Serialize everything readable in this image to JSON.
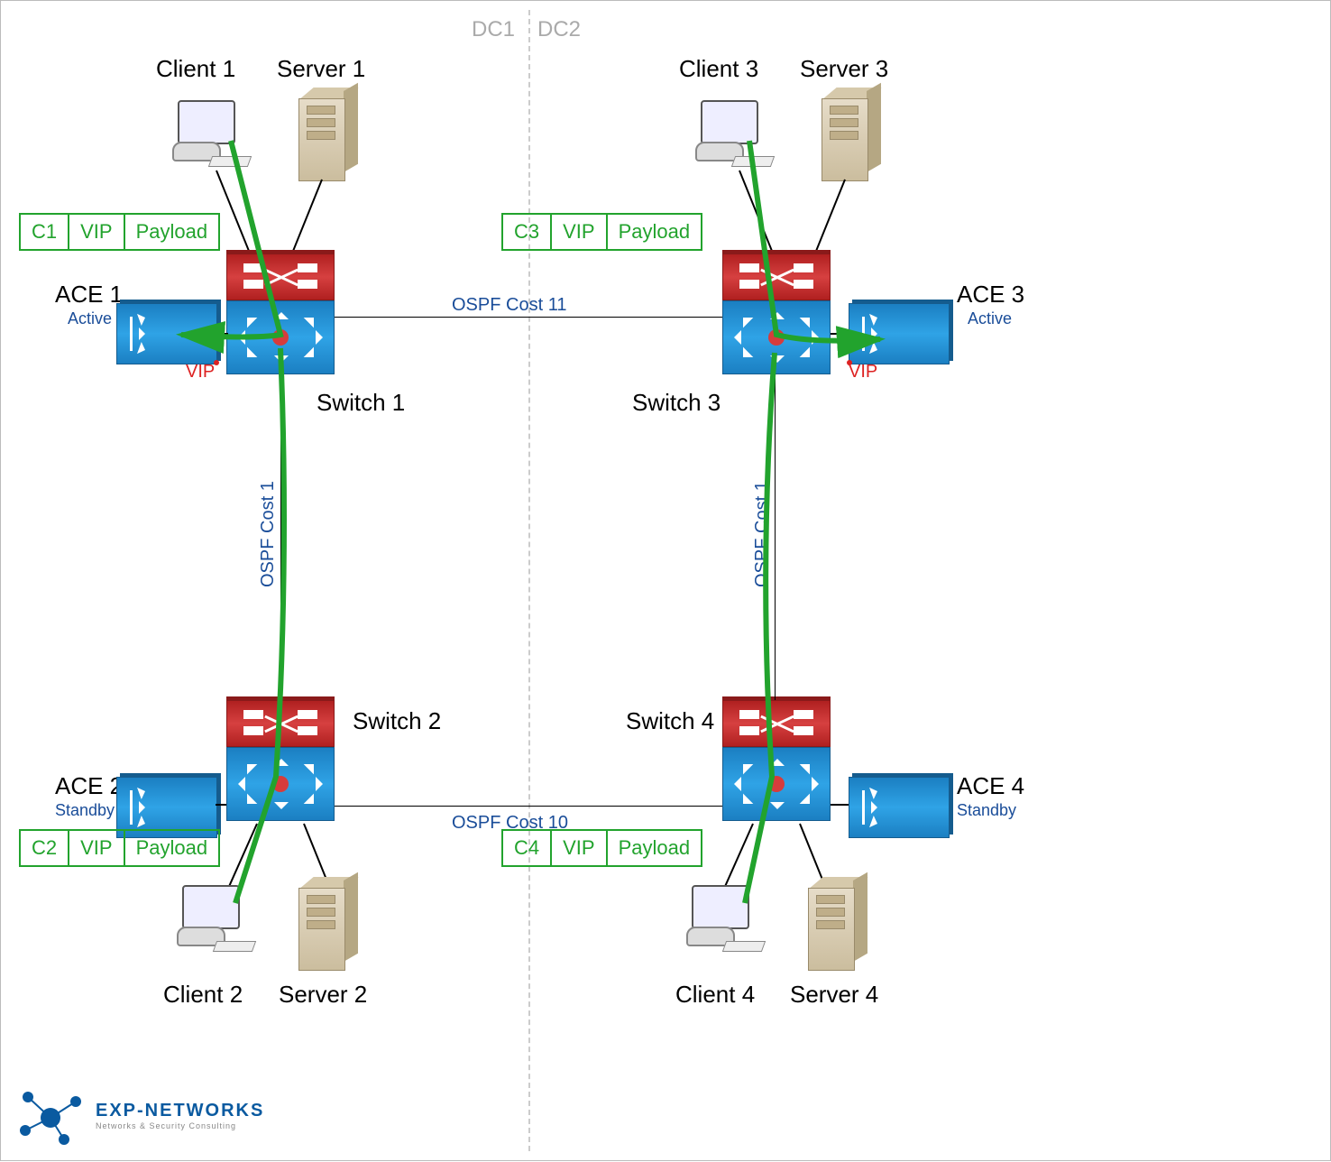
{
  "dc_labels": {
    "left": "DC1",
    "right": "DC2"
  },
  "nodes": {
    "client1": "Client 1",
    "server1": "Server 1",
    "client2": "Client 2",
    "server2": "Server 2",
    "client3": "Client 3",
    "server3": "Server 3",
    "client4": "Client 4",
    "server4": "Server 4",
    "switch1": "Switch 1",
    "switch2": "Switch 2",
    "switch3": "Switch 3",
    "switch4": "Switch 4",
    "ace1": "ACE 1",
    "ace2": "ACE 2",
    "ace3": "ACE 3",
    "ace4": "ACE 4"
  },
  "ace_status": {
    "ace1": "Active",
    "ace2": "Standby",
    "ace3": "Active",
    "ace4": "Standby"
  },
  "vip_label": "VIP",
  "ospf": {
    "top": "OSPF Cost 11",
    "bottom": "OSPF Cost 10",
    "left": "OSPF Cost 1",
    "right": "OSPF Cost 1"
  },
  "packets": {
    "p1": {
      "src": "C1",
      "mid": "VIP",
      "pl": "Payload"
    },
    "p2": {
      "src": "C2",
      "mid": "VIP",
      "pl": "Payload"
    },
    "p3": {
      "src": "C3",
      "mid": "VIP",
      "pl": "Payload"
    },
    "p4": {
      "src": "C4",
      "mid": "VIP",
      "pl": "Payload"
    }
  },
  "logo": {
    "name": "EXP-NETWORKS",
    "tagline": "Networks & Security Consulting"
  }
}
